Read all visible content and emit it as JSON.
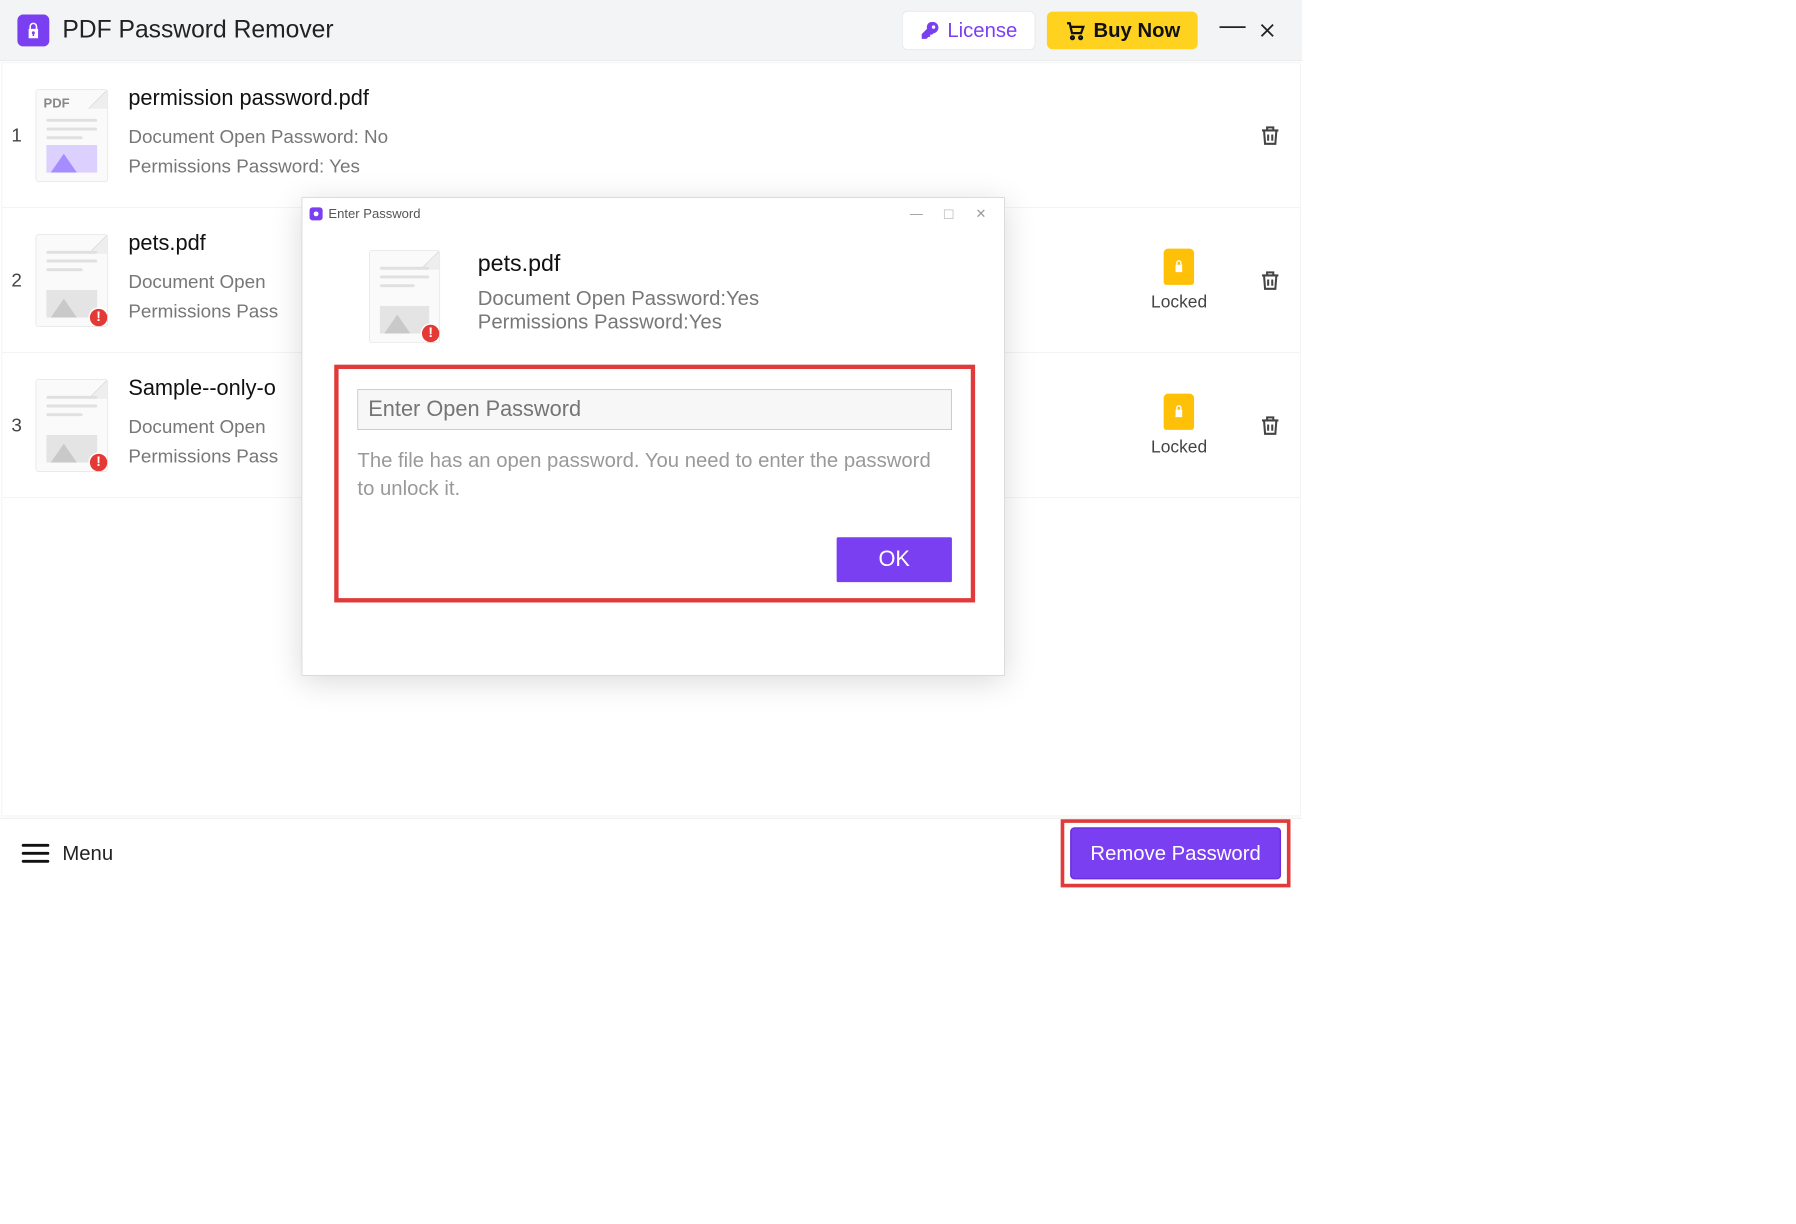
{
  "header": {
    "app_title": "PDF Password Remover",
    "license_label": "License",
    "buy_label": "Buy Now"
  },
  "files": [
    {
      "index": "1",
      "name": "permission password.pdf",
      "open_pwd_line": "Document Open Password: No",
      "perm_pwd_line": "Permissions Password: Yes",
      "locked": false
    },
    {
      "index": "2",
      "name": "pets.pdf",
      "open_pwd_line": "Document Open",
      "perm_pwd_line": "Permissions Pass",
      "locked": true,
      "locked_label": "Locked"
    },
    {
      "index": "3",
      "name": "Sample--only-o",
      "open_pwd_line": "Document Open",
      "perm_pwd_line": "Permissions Pass",
      "locked": true,
      "locked_label": "Locked"
    }
  ],
  "dialog": {
    "title": "Enter Password",
    "file_name": "pets.pdf",
    "open_pwd_line": "Document Open Password:Yes",
    "perm_pwd_line": "Permissions Password:Yes",
    "input_placeholder": "Enter Open Password",
    "hint": "The file has an open password. You need to enter the password to unlock it.",
    "ok_label": "OK"
  },
  "footer": {
    "menu_label": "Menu",
    "remove_label": "Remove Password"
  }
}
